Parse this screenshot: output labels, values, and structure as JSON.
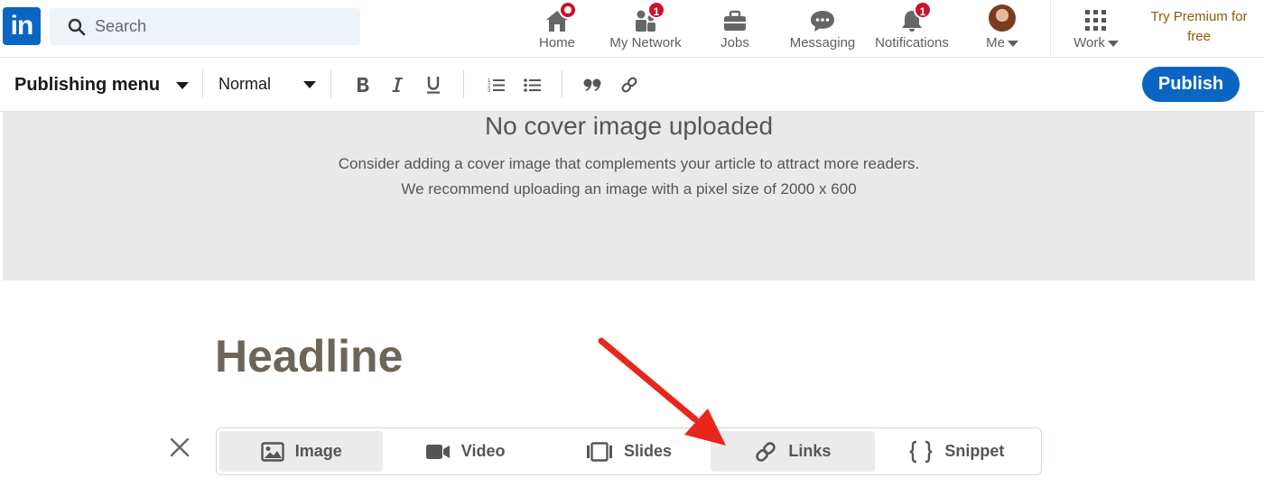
{
  "nav": {
    "search_placeholder": "Search",
    "items": [
      {
        "label": "Home",
        "badge": ""
      },
      {
        "label": "My Network",
        "badge": "1"
      },
      {
        "label": "Jobs",
        "badge": ""
      },
      {
        "label": "Messaging",
        "badge": ""
      },
      {
        "label": "Notifications",
        "badge": "1"
      },
      {
        "label": "Me",
        "badge": ""
      },
      {
        "label": "Work",
        "badge": ""
      }
    ],
    "premium": "Try Premium for free",
    "logo_text": "in"
  },
  "toolbar": {
    "menu_label": "Publishing menu",
    "text_style": "Normal",
    "publish_label": "Publish"
  },
  "cover": {
    "title": "No cover image uploaded",
    "line1": "Consider adding a cover image that complements your article to attract more readers.",
    "line2": "We recommend uploading an image with a pixel size of 2000 x 600"
  },
  "editor": {
    "headline_placeholder": "Headline"
  },
  "inserter": {
    "items": [
      {
        "label": "Image",
        "icon": "image-icon"
      },
      {
        "label": "Video",
        "icon": "video-icon"
      },
      {
        "label": "Slides",
        "icon": "slides-icon"
      },
      {
        "label": "Links",
        "icon": "link-icon"
      },
      {
        "label": "Snippet",
        "icon": "code-braces-icon"
      }
    ]
  },
  "colors": {
    "brand": "#0a66c2",
    "badge": "#cb112d",
    "premium": "#915907",
    "annotation_arrow": "#e8261b"
  }
}
